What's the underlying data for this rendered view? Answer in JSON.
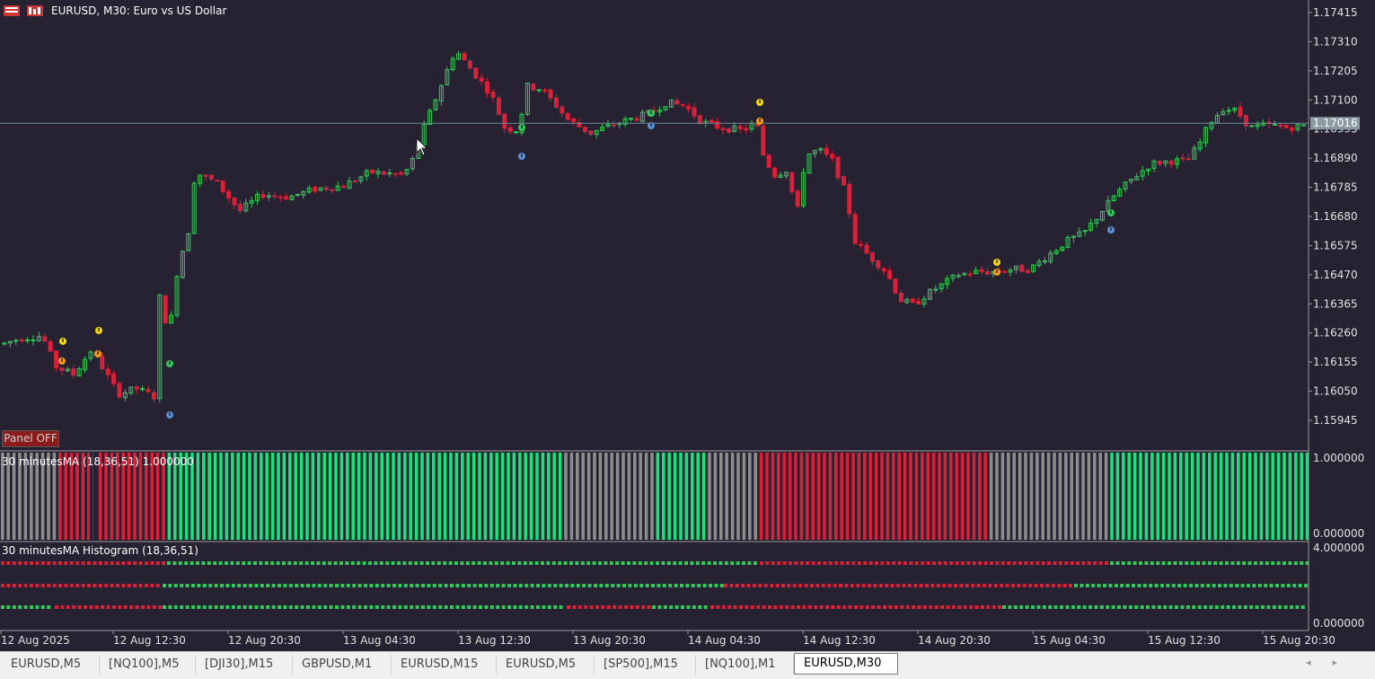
{
  "window": {
    "title": "EURUSD, M30:  Euro vs US Dollar"
  },
  "price_axis": {
    "labels": [
      "1.17415",
      "1.17310",
      "1.17205",
      "1.17100",
      "1.16995",
      "1.16890",
      "1.16785",
      "1.16680",
      "1.16575",
      "1.16470",
      "1.16365",
      "1.16260",
      "1.16155",
      "1.16050",
      "1.15945"
    ],
    "current_price": "1.17016"
  },
  "time_axis": {
    "labels": [
      "12 Aug 2025",
      "12 Aug 12:30",
      "12 Aug 20:30",
      "13 Aug 04:30",
      "13 Aug 12:30",
      "13 Aug 20:30",
      "14 Aug 04:30",
      "14 Aug 12:30",
      "14 Aug 20:30",
      "15 Aug 04:30",
      "15 Aug 12:30",
      "15 Aug 20:30"
    ]
  },
  "indicator1": {
    "label": "30 minutesMA  (18,36,51) 1.000000",
    "scale_top": "1.000000",
    "scale_bottom": "0.000000"
  },
  "indicator2": {
    "label": "30 minutesMA Histogram (18,36,51)",
    "scale_top": "4.000000",
    "scale_bottom": "0.000000"
  },
  "panel_button": "Panel  OFF",
  "tabs": [
    "EURUSD,M5",
    "[NQ100],M5",
    "[DJI30],M15",
    "GBPUSD,M1",
    "EURUSD,M15",
    "EURUSD,M5",
    "[SP500],M15",
    "[NQ100],M1",
    "EURUSD,M30"
  ],
  "active_tab": "EURUSD,M30",
  "colors": {
    "background": "#262231",
    "bull": "#34c759",
    "bear": "#d9213a",
    "neutral": "#8c8c8c",
    "histogram_green": "#1ee07a",
    "price_line": "#6b8a96"
  }
}
